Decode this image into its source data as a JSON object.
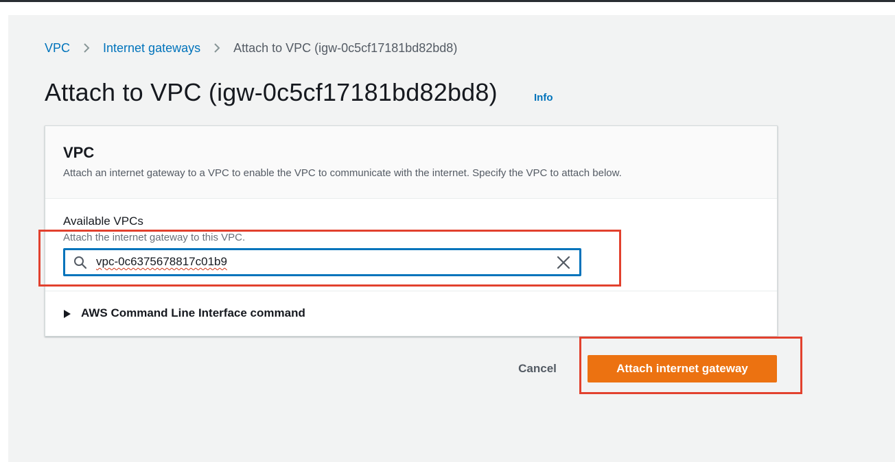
{
  "colors": {
    "link": "#0073bb",
    "primary_button": "#ec7211",
    "highlight": "#e2412e",
    "page_background": "#f2f3f3"
  },
  "breadcrumb": {
    "items": [
      {
        "label": "VPC"
      },
      {
        "label": "Internet gateways"
      },
      {
        "label": "Attach to VPC (igw-0c5cf17181bd82bd8)"
      }
    ],
    "separator_icon": "chevron-right-icon"
  },
  "page": {
    "title": "Attach to VPC (igw-0c5cf17181bd82bd8)",
    "info_link": "Info"
  },
  "panel": {
    "title": "VPC",
    "description": "Attach an internet gateway to a VPC to enable the VPC to communicate with the internet. Specify the VPC to attach below.",
    "field": {
      "label": "Available VPCs",
      "description": "Attach the internet gateway to this VPC.",
      "value": "vpc-0c6375678817c01b9",
      "search_icon": "search-icon",
      "clear_icon": "close-icon"
    },
    "cli_section": {
      "label": "AWS Command Line Interface command",
      "icon": "caret-right-icon"
    }
  },
  "actions": {
    "cancel": "Cancel",
    "submit": "Attach internet gateway"
  }
}
